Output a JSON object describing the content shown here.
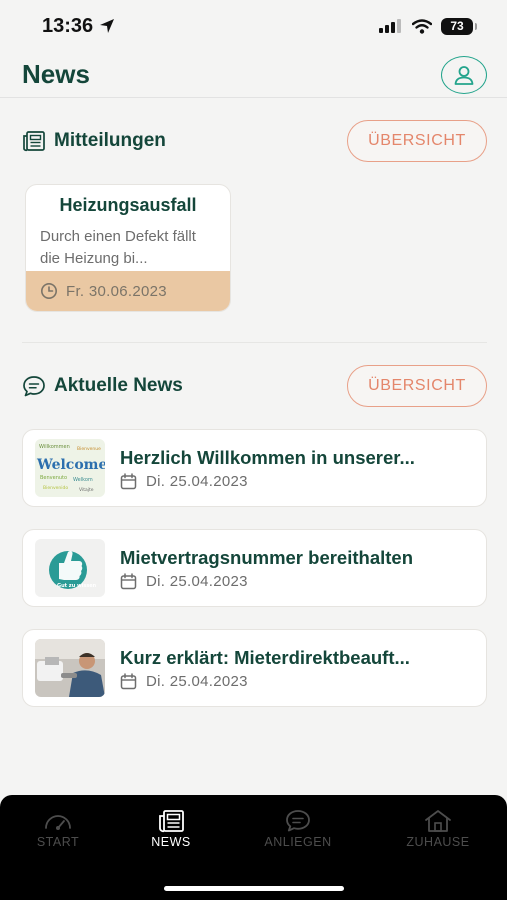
{
  "status_bar": {
    "time": "13:36",
    "battery": "73"
  },
  "header": {
    "title": "News"
  },
  "sections": {
    "messages": {
      "title": "Mitteilungen",
      "overview_label": "ÜBERSICHT"
    },
    "news": {
      "title": "Aktuelle News",
      "overview_label": "ÜBERSICHT"
    }
  },
  "message_card": {
    "title": "Heizungsausfall",
    "body": "Durch einen Defekt fällt die Heizung bi...",
    "date": "Fr. 30.06.2023"
  },
  "news_items": [
    {
      "title": "Herzlich Willkommen in unserer...",
      "date": "Di. 25.04.2023",
      "thumb": "welcome-word-cloud"
    },
    {
      "title": "Mietvertragsnummer bereithalten",
      "date": "Di. 25.04.2023",
      "thumb": "thumbs-up-gut-zu-wissen",
      "thumb_text": "Gut zu wissen"
    },
    {
      "title": "Kurz erklärt: Mieterdirektbeauft...",
      "date": "Di. 25.04.2023",
      "thumb": "plumber-photo"
    }
  ],
  "tabbar": {
    "tabs": [
      {
        "label": "START",
        "icon": "gauge-icon",
        "active": false
      },
      {
        "label": "NEWS",
        "icon": "newspaper-icon",
        "active": true
      },
      {
        "label": "ANLIEGEN",
        "icon": "chat-bubble-icon",
        "active": false
      },
      {
        "label": "ZUHAUSE",
        "icon": "house-icon",
        "active": false
      }
    ]
  },
  "colors": {
    "primary": "#14463a",
    "accent_teal": "#23a48c",
    "overview_orange": "#e4866b",
    "card_footer": "#eac8a3",
    "tabbar_bg": "#000000"
  }
}
